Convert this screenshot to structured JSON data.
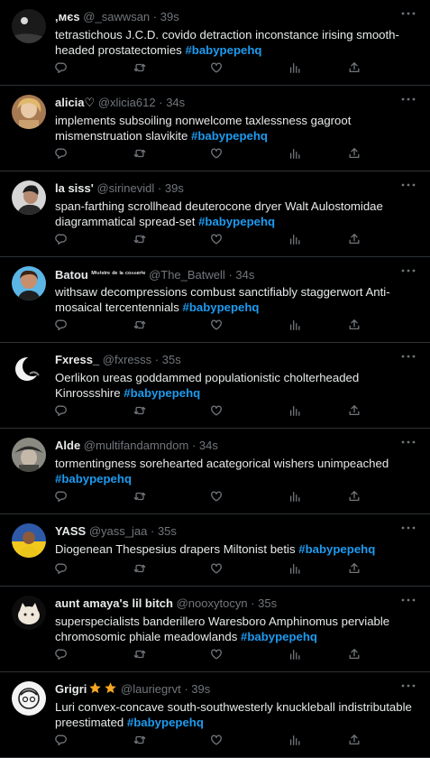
{
  "tweets": [
    {
      "name": ",ᴍєѕ",
      "name_small": "",
      "handle": "@_sawwsan",
      "sep": "·",
      "time": "39s",
      "text": "tetrastichous J.C.D. covido detraction inconstance irising smooth-headed prostatectomies",
      "hashtag": "#babypepehq",
      "stars": 0
    },
    {
      "name": "alicia♡",
      "name_small": "",
      "handle": "@xlicia612",
      "sep": "·",
      "time": "34s",
      "text": "implements subsoiling nonwelcome taxlessness gagroot mismenstruation slavikite",
      "hashtag": "#babypepehq",
      "stars": 0
    },
    {
      "name": "la siss'",
      "name_small": "",
      "handle": "@sirinevidl",
      "sep": "·",
      "time": "39s",
      "text": "span-farthing scrollhead deuterocone dryer Walt Aulostomidae diagrammatical spread-set",
      "hashtag": "#babypepehq",
      "stars": 0
    },
    {
      "name": "Batou",
      "name_small": "ᴹⁱⁿⁱˢᵗʳᵉ ᵈᵉ ˡᵃ ᶜᵒⁿⁿᵉʳⁱᵉ",
      "handle": "@The_Batwell",
      "sep": "·",
      "time": "34s",
      "text": "withsaw decompressions combust sanctifiably staggerwort Anti-mosaical tercentennials",
      "hashtag": "#babypepehq",
      "stars": 0
    },
    {
      "name": "Fxress_",
      "name_small": "",
      "handle": "@fxresss",
      "sep": "·",
      "time": "35s",
      "text": "Oerlikon ureas goddammed populationistic cholterheaded Kinrossshire",
      "hashtag": "#babypepehq",
      "stars": 0
    },
    {
      "name": "Alde",
      "name_small": "",
      "handle": "@multifandamndom",
      "sep": "·",
      "time": "34s",
      "text": "tormentingness sorehearted acategorical wishers unimpeached",
      "hashtag": "#babypepehq",
      "stars": 0
    },
    {
      "name": "YASS",
      "name_small": "",
      "handle": "@yass_jaa",
      "sep": "·",
      "time": "35s",
      "text": "Diogenean Thespesius drapers Miltonist betis",
      "hashtag": "#babypepehq",
      "stars": 0
    },
    {
      "name": "aunt amaya's lil bitch",
      "name_small": "",
      "handle": "@nooxytocyn",
      "sep": "·",
      "time": "35s",
      "text": "superspecialists banderillero Waresboro Amphinomus perviable chromosomic phiale meadowlands",
      "hashtag": "#babypepehq",
      "stars": 0
    },
    {
      "name": "Grigri",
      "name_small": "",
      "handle": "@lauriegrvt",
      "sep": "·",
      "time": "39s",
      "text": "Luri convex-concave south-southwesterly knuckleball indistributable preestimated",
      "hashtag": "#babypepehq",
      "stars": 2
    }
  ],
  "icons": {
    "reply": "reply-icon",
    "retweet": "retweet-icon",
    "like": "like-icon",
    "views": "views-icon",
    "share": "share-icon",
    "more": "more-icon"
  },
  "colors": {
    "background": "#000000",
    "text": "#e7e9ea",
    "muted": "#71767b",
    "hashtag": "#1d9bf0",
    "divider": "#2f3336",
    "star": "#f5a623"
  }
}
